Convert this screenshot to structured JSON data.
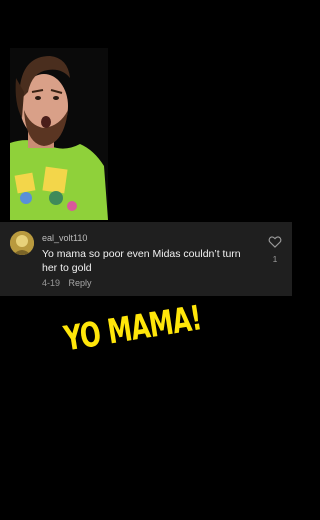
{
  "comment": {
    "username": "eal_volt110",
    "text": "Yo mama so poor even Midas couldn’t turn her to gold",
    "date": "4-19",
    "reply_label": "Reply",
    "like_count": "1"
  },
  "caption": {
    "text": "YO MAMA!"
  },
  "colors": {
    "caption": "#ffe60a",
    "card": "#1f1f1f",
    "background": "#000000",
    "shirt": "#8fd13a"
  },
  "icons": [
    "heart-outline-icon"
  ]
}
